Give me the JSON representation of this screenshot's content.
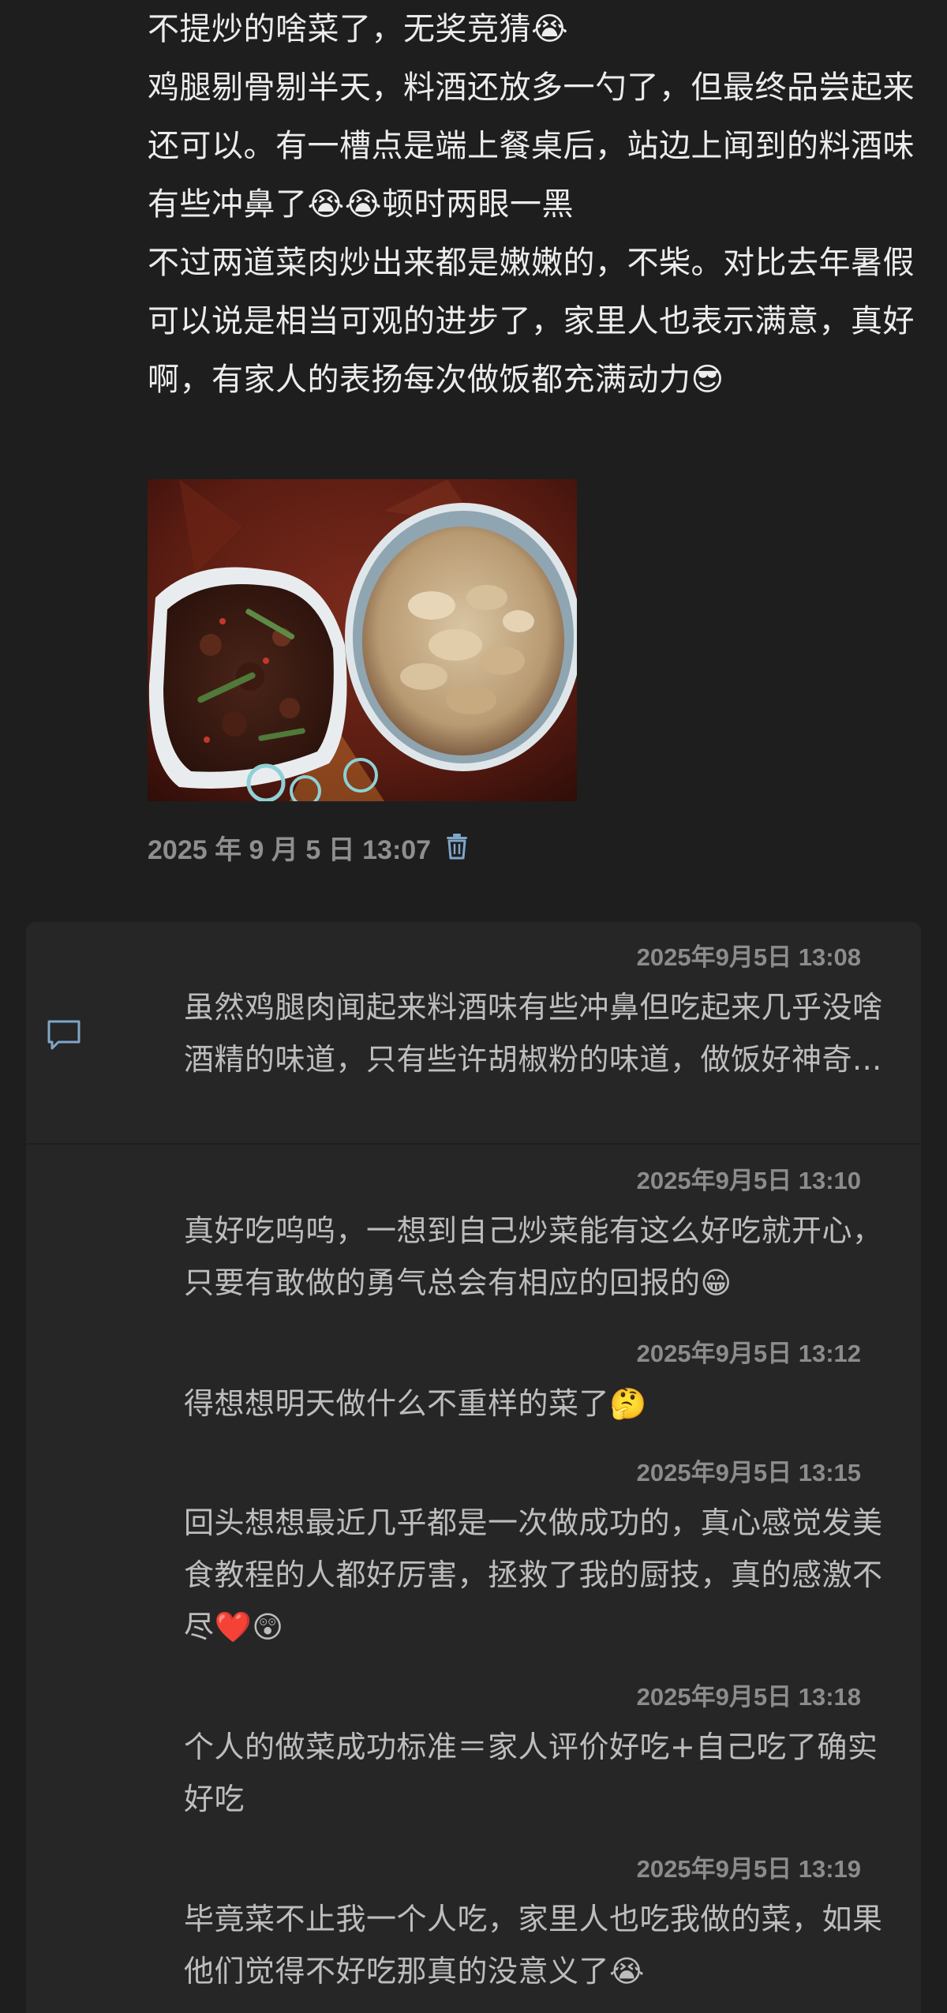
{
  "post": {
    "paragraphs": [
      "不提炒的啥菜了，无奖竞猜😭",
      "鸡腿剔骨剔半天，料酒还放多一勺了，但最终品尝起来还可以。有一槽点是端上餐桌后，站边上闻到的料酒味有些冲鼻了😭😭顿时两眼一黑",
      "不过两道菜肉炒出来都是嫩嫩的，不柴。对比去年暑假可以说是相当可观的进步了，家里人也表示满意，真好啊，有家人的表扬每次做饭都充满动力😎"
    ],
    "timestamp": "2025 年 9 月 5 日 13:07"
  },
  "comments": [
    {
      "time": "2025年9月5日 13:08",
      "text": "虽然鸡腿肉闻起来料酒味有些冲鼻但吃起来几乎没啥酒精的味道，只有些许胡椒粉的味道，做饭好神奇..."
    },
    {
      "time": "2025年9月5日 13:10",
      "text": "真好吃呜呜，一想到自己炒菜能有这么好吃就开心，只要有敢做的勇气总会有相应的回报的😁"
    },
    {
      "time": "2025年9月5日 13:12",
      "text": "得想想明天做什么不重样的菜了🤔"
    },
    {
      "time": "2025年9月5日 13:15",
      "text": "回头想想最近几乎都是一次做成功的，真心感觉发美食教程的人都好厉害，拯救了我的厨技，真的感激不尽❤️😲"
    },
    {
      "time": "2025年9月5日 13:18",
      "text": "个人的做菜成功标准＝家人评价好吃+自己吃了确实好吃"
    },
    {
      "time": "2025年9月5日 13:19",
      "text": "毕竟菜不止我一个人吃，家里人也吃我做的菜，如果他们觉得不好吃那真的没意义了😭"
    }
  ],
  "colors": {
    "background": "#1e1e1e",
    "card": "#262626",
    "text_primary": "#ececec",
    "text_secondary": "#bdbdbd",
    "meta": "#8c8c8c",
    "accent_icon": "#7fa6c9"
  },
  "icons": {
    "delete": "trash-icon",
    "comment": "comment-icon"
  }
}
